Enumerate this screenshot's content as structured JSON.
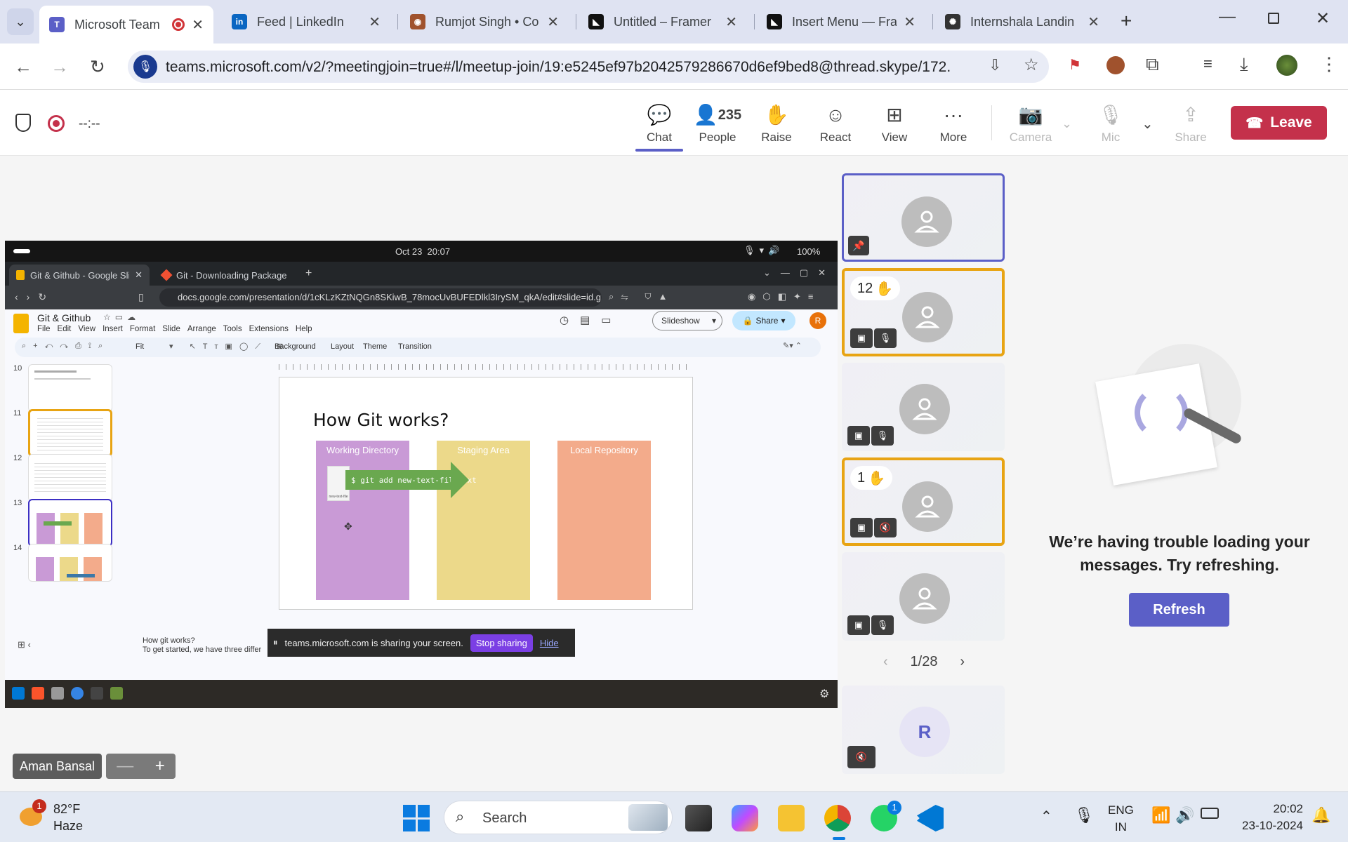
{
  "browser": {
    "tabs": [
      {
        "title": "Microsoft Team",
        "icon": "teams-icon",
        "active": true,
        "color": "#5b5fc7"
      },
      {
        "title": "Feed | LinkedIn",
        "icon": "linkedin-icon",
        "active": false,
        "color": "#0a66c2"
      },
      {
        "title": "Rumjot Singh • Co",
        "icon": "owl-icon",
        "active": false,
        "color": "#a0522d"
      },
      {
        "title": "Untitled – Framer",
        "icon": "framer-icon",
        "active": false,
        "color": "#111111"
      },
      {
        "title": "Insert Menu — Fra",
        "icon": "framer-icon",
        "active": false,
        "color": "#111111"
      },
      {
        "title": "Internshala Landin",
        "icon": "openai-icon",
        "active": false,
        "color": "#333333"
      }
    ],
    "url": "teams.microsoft.com/v2/?meetingjoin=true#/l/meetup-join/19:e5245ef97b2042579286670d6ef9bed8@thread.skype/172..."
  },
  "teams": {
    "timer": "--:--",
    "toolbar": {
      "chat": "Chat",
      "people": "People",
      "people_count": "235",
      "raise": "Raise",
      "react": "React",
      "view": "View",
      "more": "More",
      "camera": "Camera",
      "mic": "Mic",
      "share": "Share",
      "leave": "Leave"
    },
    "pager": "1/28",
    "participant_initial": "R",
    "hand_counts": [
      "12",
      "1"
    ],
    "chat_error": "We’re having trouble loading your messages. Try refreshing.",
    "refresh": "Refresh",
    "presenter_name": "Aman Bansal",
    "zoom_minus": "—",
    "zoom_plus": "+"
  },
  "shared_screen": {
    "datetime": "Oct 23  20:07",
    "battery": "100%",
    "tabs": [
      "Git & Github - Google Sli",
      "Git - Downloading Package"
    ],
    "url": "docs.google.com/presentation/d/1cKLzKZtNQGn8SKiwB_78mocUvBUFEDlkl3IrySM_qkA/edit#slide=id.g2f...",
    "doc_title": "Git & Github",
    "menu": [
      "File",
      "Edit",
      "View",
      "Insert",
      "Format",
      "Slide",
      "Arrange",
      "Tools",
      "Extensions",
      "Help"
    ],
    "slideshow": "Slideshow",
    "share": "Share",
    "avatar_letter": "R",
    "toolbar": {
      "zoom": "Fit",
      "background": "Background",
      "layout": "Layout",
      "theme": "Theme",
      "transition": "Transition"
    },
    "thumb_numbers": [
      "10",
      "11",
      "12",
      "13",
      "14"
    ],
    "slide": {
      "title": "How Git works?",
      "columns": [
        "Working Directory",
        "Staging Area",
        "Local Repository"
      ],
      "command": "$ git add new-text-file.txt",
      "file_label": "new-text-file"
    },
    "notes": [
      "How git works?",
      "To get started, we have three differ"
    ],
    "sharing_notice": "teams.microsoft.com is sharing your screen.",
    "stop_sharing": "Stop sharing",
    "hide": "Hide"
  },
  "taskbar": {
    "weather_temp": "82°F",
    "weather_desc": "Haze",
    "weather_badge": "1",
    "search_placeholder": "Search",
    "whatsapp_badge": "1",
    "lang": "ENG",
    "region": "IN",
    "time": "20:02",
    "date": "23-10-2024"
  },
  "colors": {
    "teams_purple": "#5b5fc7",
    "leave_red": "#c4314b",
    "raised_hand_border": "#e8a413",
    "pinned_border": "#5b5fc7",
    "col_working": "#c99ad6",
    "col_staging": "#ecd98a",
    "col_local": "#f3ab8b"
  }
}
